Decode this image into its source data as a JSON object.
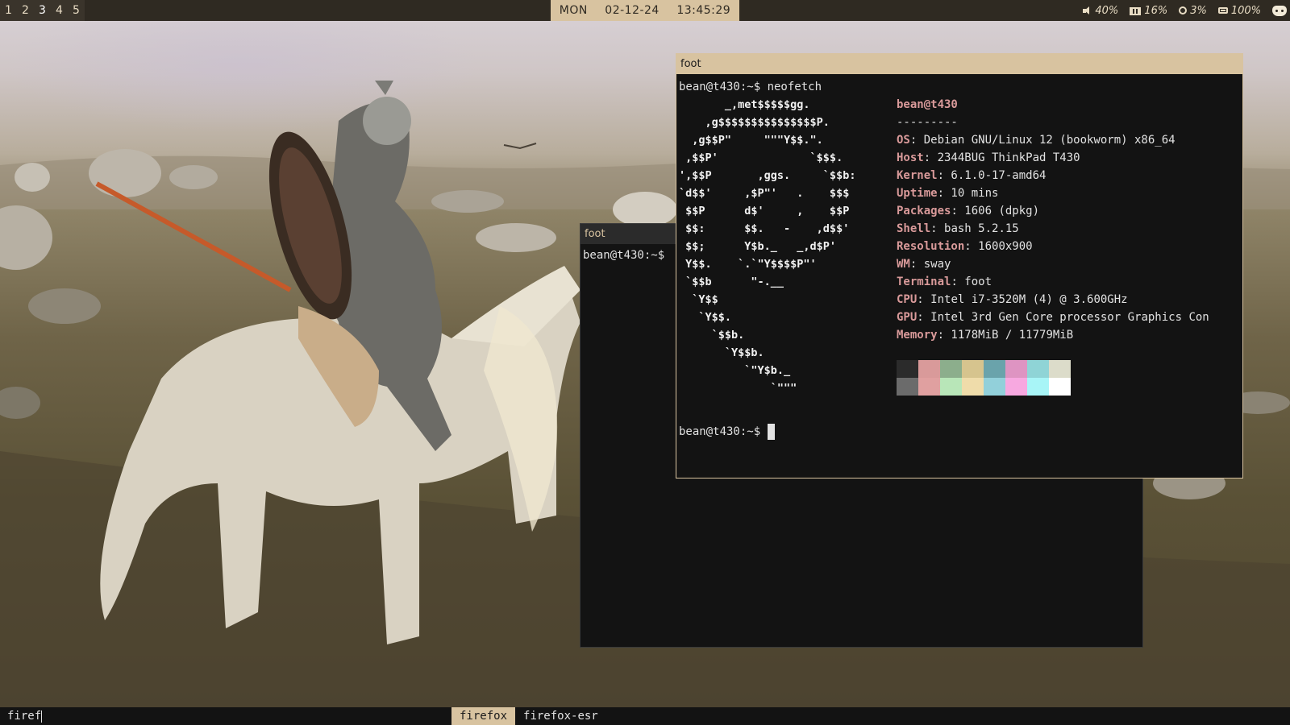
{
  "topbar": {
    "workspaces": [
      "1",
      "2",
      "3",
      "4",
      "5"
    ],
    "active_workspace": "3",
    "clock": {
      "day": "MON",
      "date": "02-12-24",
      "time": "13:45:29"
    },
    "status": {
      "volume": "40%",
      "memory": "16%",
      "cpu": "3%",
      "battery": "100%"
    },
    "icons": [
      "volume-icon",
      "memory-icon",
      "cpu-icon",
      "battery-icon",
      "discord-icon"
    ]
  },
  "windows": {
    "back": {
      "title": "foot",
      "prompt": "bean@t430:~$"
    },
    "front": {
      "title": "foot",
      "command_line": "bean@t430:~$ neofetch",
      "ascii_art": "       _,met$$$$$gg.\n    ,g$$$$$$$$$$$$$$$P.\n  ,g$$P\"     \"\"\"Y$$.\".\n ,$$P'              `$$$.\n',$$P       ,ggs.     `$$b:\n`d$$'     ,$P\"'   .    $$$\n $$P      d$'     ,    $$P\n $$:      $$.   -    ,d$$'\n $$;      Y$b._   _,d$P'\n Y$$.    `.`\"Y$$$$P\"'\n `$$b      \"-.__\n  `Y$$\n   `Y$$.\n     `$$b.\n       `Y$$b.\n          `\"Y$b._\n              `\"\"\"",
      "user_host": "bean@t430",
      "separator": "---------",
      "info": [
        {
          "key": "OS",
          "value": ": Debian GNU/Linux 12 (bookworm) x86_64"
        },
        {
          "key": "Host",
          "value": ": 2344BUG ThinkPad T430"
        },
        {
          "key": "Kernel",
          "value": ": 6.1.0-17-amd64"
        },
        {
          "key": "Uptime",
          "value": ": 10 mins"
        },
        {
          "key": "Packages",
          "value": ": 1606 (dpkg)"
        },
        {
          "key": "Shell",
          "value": ": bash 5.2.15"
        },
        {
          "key": "Resolution",
          "value": ": 1600x900"
        },
        {
          "key": "WM",
          "value": ": sway"
        },
        {
          "key": "Terminal",
          "value": ": foot"
        },
        {
          "key": "CPU",
          "value": ": Intel i7-3520M (4) @ 3.600GHz"
        },
        {
          "key": "GPU",
          "value": ": Intel 3rd Gen Core processor Graphics Con"
        },
        {
          "key": "Memory",
          "value": ": 1178MiB / 11779MiB"
        }
      ],
      "palette_colors": [
        "#2b2b2b",
        "#d99a9a",
        "#8cae8c",
        "#d6c48e",
        "#6aa3ab",
        "#de94c2",
        "#8fd4d6",
        "#dcdcca",
        "#6b6b6b",
        "#e0a0a0",
        "#b8e6b8",
        "#efdcaa",
        "#92d0da",
        "#f7a8e0",
        "#a8f5f7",
        "#ffffff"
      ],
      "prompt": "bean@t430:~$"
    }
  },
  "launcher": {
    "query": "firef",
    "results": [
      "firefox",
      "firefox-esr"
    ],
    "selected": "firefox"
  },
  "colors": {
    "accent": "#d8c3a0",
    "bar_bg": "#2f2a22",
    "terminal_bg": "#131313",
    "key_color": "#d99a9a"
  }
}
